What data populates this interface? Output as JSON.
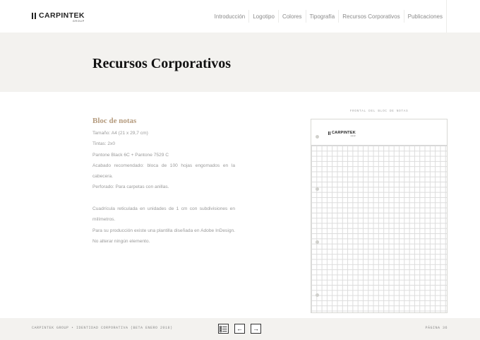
{
  "brand": {
    "name": "CARPINTEK",
    "sub": "GROUP"
  },
  "nav": {
    "items": [
      {
        "label": "Introducción"
      },
      {
        "label": "Logotipo"
      },
      {
        "label": "Colores"
      },
      {
        "label": "Tipografía"
      },
      {
        "label": "Recursos Corporativos"
      },
      {
        "label": "Publicaciones"
      }
    ]
  },
  "page": {
    "title": "Recursos Corporativos"
  },
  "content": {
    "section_title": "Bloc de notas",
    "lines_a": [
      "Tamaño: A4 (21 x 29,7 cm)",
      "Tintas: 2x0",
      "Pantone Black 6C + Pantone 7529 C",
      "Acabado recomendado: bloca de 100 hojas engomados en la cabecera.",
      "Perforado: Para carpetas con anillas."
    ],
    "lines_b": [
      "Cuadrícula reticulada en unidades de 1 cm con subdivisiones en milímetros.",
      "Para su producción existe una plantilla diseñada en Adobe InDesign. No alterar ningún elemento."
    ]
  },
  "preview": {
    "caption": "FRONTAL DEL BLOC DE NOTAS",
    "logo_name": "CARPINTEK",
    "logo_sub": "GROUP"
  },
  "footer": {
    "left": "CARPINTEK GROUP • IDENTIDAD CORPORATIVA (BETA ENERO 2018)",
    "right": "PÁGINA 36",
    "index_icon": "list-index-icon",
    "prev_icon": "arrow-left-icon",
    "next_icon": "arrow-right-icon",
    "prev_glyph": "←",
    "next_glyph": "→"
  }
}
